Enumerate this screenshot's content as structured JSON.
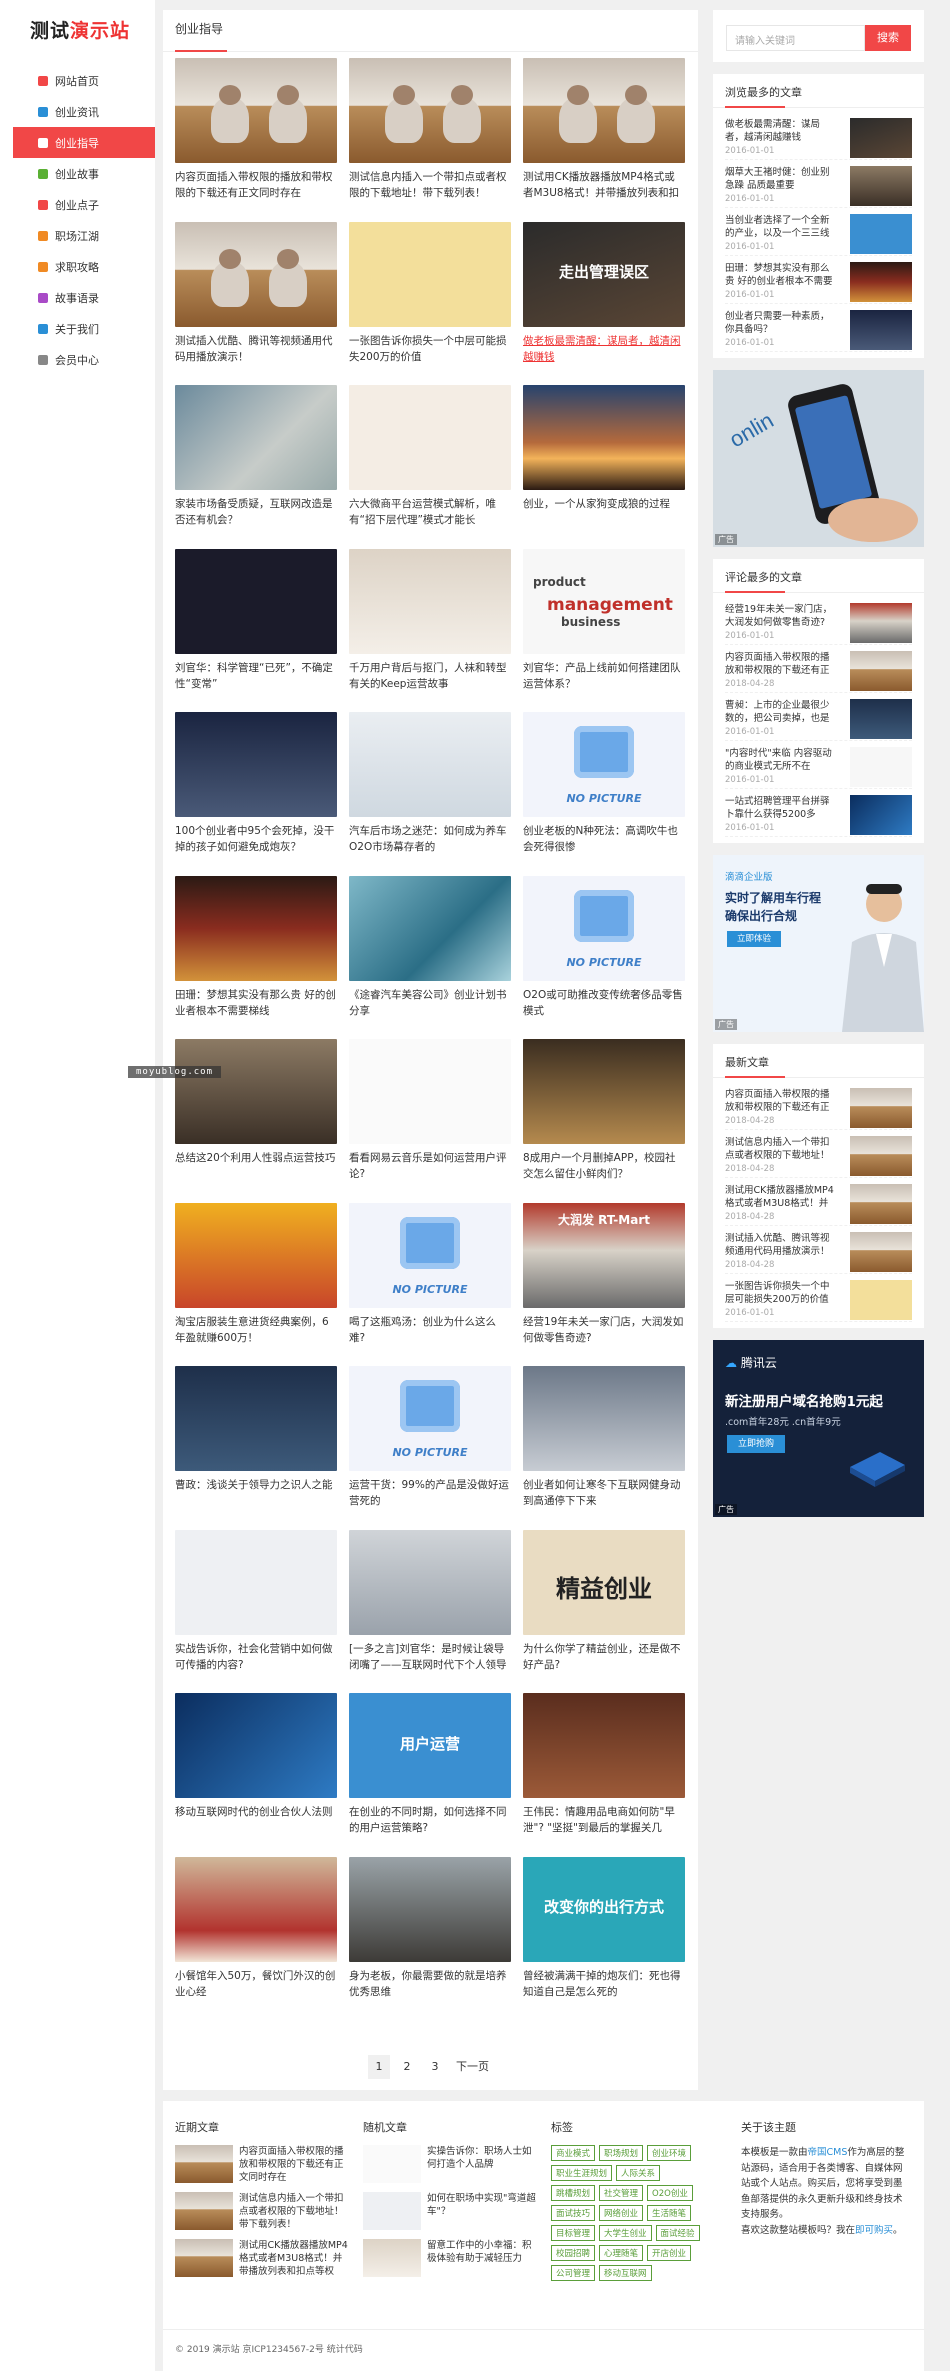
{
  "site": {
    "logo_a": "测试",
    "logo_b": "演示站"
  },
  "nav": [
    {
      "label": "网站首页",
      "icon": "home-icon",
      "color": "#f14747"
    },
    {
      "label": "创业资讯",
      "icon": "question-icon",
      "color": "#2a8fd6"
    },
    {
      "label": "创业指导",
      "icon": "send-icon",
      "color": "#f14747",
      "active": true
    },
    {
      "label": "创业故事",
      "icon": "heart-icon",
      "color": "#5ab034"
    },
    {
      "label": "创业点子",
      "icon": "gift-icon",
      "color": "#f14747"
    },
    {
      "label": "职场江湖",
      "icon": "tag-icon",
      "color": "#f08a24"
    },
    {
      "label": "求职攻略",
      "icon": "page-icon",
      "color": "#f08a24"
    },
    {
      "label": "故事语录",
      "icon": "list-icon",
      "color": "#a94bc7"
    },
    {
      "label": "关于我们",
      "icon": "star-icon",
      "color": "#2a8fd6"
    },
    {
      "label": "会员中心",
      "icon": "user-icon",
      "color": "#888888"
    }
  ],
  "main": {
    "heading": "创业指导",
    "cards": [
      {
        "title": "内容页面插入带权限的播放和带权限的下载还有正文同时存在",
        "thumb": "t-photo1"
      },
      {
        "title": "测试信息内插入一个带扣点或者权限的下载地址！带下载列表！",
        "thumb": "t-photo1"
      },
      {
        "title": "测试用CK播放器播放MP4格式或者M3U8格式！并带播放列表和扣点等权限！",
        "thumb": "t-photo1"
      },
      {
        "title": "测试插入优酷、腾讯等视频通用代码用播放演示！",
        "thumb": "t-photo1"
      },
      {
        "title": "一张图告诉你损失一个中层可能损失200万的价值",
        "thumb": "t-yellow"
      },
      {
        "title": "做老板最需清醒：谋局者，越清闲越赚钱",
        "thumb": "t-dark",
        "red": true,
        "overlay": "走出管理误区"
      },
      {
        "title": "家装市场备受质疑，互联网改造是否还有机会？",
        "thumb": "t-phone"
      },
      {
        "title": "六大微商平台运营模式解析，唯有“招下层代理”模式才能长",
        "thumb": "t-grid6"
      },
      {
        "title": "创业，一个从家狗变成狼的过程",
        "thumb": "t-sunset"
      },
      {
        "title": "刘官华：科学管理“已死”，不确定性“变常”",
        "thumb": "t-slide"
      },
      {
        "title": "千万用户背后与抠门，人袜和转型有关的Keep运营故事",
        "thumb": "t-room"
      },
      {
        "title": "刘官华：产品上线前如何搭建团队运营体系？",
        "thumb": "t-words",
        "overlay_words": [
          "product",
          "management",
          "business"
        ]
      },
      {
        "title": "100个创业者中95个会死掉，没干掉的孩子如何避免成炮灰？",
        "thumb": "t-night"
      },
      {
        "title": "汽车后市场之迷茫：如何成为养车O2O市场幕存者的",
        "thumb": "t-tire"
      },
      {
        "title": "创业老板的N种死法：高调吹牛也会死得很惨",
        "thumb": "t-nopic",
        "nopic": "NO PICTURE"
      },
      {
        "title": "田珊：梦想其实没有那么贵 好的创业者根本不需要梯线",
        "thumb": "t-temple"
      },
      {
        "title": "《途睿汽车美容公司》创业计划书分享",
        "thumb": "t-car"
      },
      {
        "title": "O2O或可助推改变传统奢侈品零售模式",
        "thumb": "t-nopic",
        "nopic": "NO PICTURE"
      },
      {
        "title": "总结这20个利用人性弱点运营技巧",
        "thumb": "t-man"
      },
      {
        "title": "看看网易云音乐是如何运营用户评论?",
        "thumb": "t-chat"
      },
      {
        "title": "8成用户一个月删掉APP，校园社交怎么留住小鲜肉们？",
        "thumb": "t-cafe"
      },
      {
        "title": "淘宝店服装生意进货经典案例，6年盈就赚600万！",
        "thumb": "t-crowd"
      },
      {
        "title": "喝了这瓶鸡汤：创业为什么这么难?",
        "thumb": "t-nopic",
        "nopic": "NO PICTURE"
      },
      {
        "title": "经营19年未关一家门店，大润发如何做零售奇迹?",
        "thumb": "t-store",
        "overlay": "大润发 RT-Mart"
      },
      {
        "title": "曹政：浅谈关于领导力之识人之能",
        "thumb": "t-people"
      },
      {
        "title": "运营干货：99%的产品是没做好运营死的",
        "thumb": "t-nopic",
        "nopic": "NO PICTURE"
      },
      {
        "title": "创业者如何让寒冬下互联网健身动到高通停下下来",
        "thumb": "t-run"
      },
      {
        "title": "实战告诉你，社会化营销中如何做可传播的内容?",
        "thumb": "t-collage"
      },
      {
        "title": "[一多之言]刘官华：是时候让袋导闭嘴了——互联网时代下个人领导力提升",
        "thumb": "t-portrait"
      },
      {
        "title": "为什么你学了精益创业，还是做不好产品?",
        "thumb": "t-calli",
        "overlay": "精益创业"
      },
      {
        "title": "移动互联网时代的创业合伙人法则",
        "thumb": "t-tech"
      },
      {
        "title": "在创业的不同时期，如何选择不同的用户运营策略?",
        "thumb": "t-blue",
        "overlay": "用户运营"
      },
      {
        "title": "王伟民：情趣用品电商如何防\"早泄\"? \"坚挺\"到最后的掌握关几",
        "thumb": "t-brick"
      },
      {
        "title": "小餐馆年入50万，餐饮门外汉的创业心经",
        "thumb": "t-diner"
      },
      {
        "title": "身为老板，你最需要做的就是培养优秀思维",
        "thumb": "t-warriors"
      },
      {
        "title": "曾经被满满干掉的炮灰们：死也得知道自己是怎么死的",
        "thumb": "t-teal",
        "overlay": "改变你的出行方式"
      }
    ]
  },
  "pager": {
    "pages": [
      "1",
      "2",
      "3"
    ],
    "next": "下一页"
  },
  "search": {
    "placeholder": "请输入关键词",
    "button": "搜索"
  },
  "hot": {
    "heading": "浏览最多的文章",
    "items": [
      {
        "title": "做老板最需清醒：谋局者，越清闲越赚钱",
        "date": "2016-01-01",
        "thumb": "t-dark"
      },
      {
        "title": "烟草大王褚时健：创业别急躁 品质最重要",
        "date": "2016-01-01",
        "thumb": "t-man"
      },
      {
        "title": "当创业者选择了一个全新的产业，以及一个三三线城市，该怎么办？",
        "date": "2016-01-01",
        "thumb": "t-blue"
      },
      {
        "title": "田珊：梦想其实没有那么贵 好的创业者根本不需要梯线",
        "date": "2016-01-01",
        "thumb": "t-temple"
      },
      {
        "title": "创业者只需要一种素质，你具备吗？",
        "date": "2016-01-01",
        "thumb": "t-night"
      }
    ]
  },
  "ad1": {
    "tag": "广告"
  },
  "comments": {
    "heading": "评论最多的文章",
    "items": [
      {
        "title": "经营19年未关一家门店，大润发如何做零售奇迹?",
        "date": "2016-01-01",
        "thumb": "t-store"
      },
      {
        "title": "内容页面插入带权限的播放和带权限的下载还有正文同时存在",
        "date": "2018-04-28",
        "thumb": "t-photo1"
      },
      {
        "title": "曹昶：上市的企业最很少数的，把公司卖掉，也是创业者很好的选择",
        "date": "2016-01-01",
        "thumb": "t-people"
      },
      {
        "title": "\"内容时代\"来临 内容驱动的商业模式无所不在",
        "date": "2016-01-01",
        "thumb": "t-words"
      },
      {
        "title": "一站式招聘管理平台拼驿卜靠什么获得5200多",
        "date": "2016-01-01",
        "thumb": "t-tech"
      }
    ]
  },
  "ad2": {
    "brand": "滴滴企业版",
    "headline": "实时了解用车行程",
    "sub": "确保出行合规",
    "cta": "立即体验",
    "tag": "广告"
  },
  "latest": {
    "heading": "最新文章",
    "items": [
      {
        "title": "内容页面插入带权限的播放和带权限的下载还有正文同时存在",
        "date": "2018-04-28",
        "thumb": "t-photo1"
      },
      {
        "title": "测试信息内插入一个带扣点或者权限的下载地址！带下载列表！",
        "date": "2018-04-28",
        "thumb": "t-photo1"
      },
      {
        "title": "测试用CK播放器播放MP4格式或者M3U8格式！并带播放列表和扣点等权限！",
        "date": "2018-04-28",
        "thumb": "t-photo1"
      },
      {
        "title": "测试插入优酷、腾讯等视频通用代码用播放演示！",
        "date": "2018-04-28",
        "thumb": "t-photo1"
      },
      {
        "title": "一张图告诉你损失一个中层可能损失200万的价值",
        "date": "2016-01-01",
        "thumb": "t-yellow"
      }
    ]
  },
  "ad3": {
    "brand": "腾讯云",
    "headline": "新注册用户域名抢购1元起",
    "sub": ".com首年28元 .cn首年9元",
    "cta": "立即抢购",
    "tag": "广告"
  },
  "footer": {
    "recent": {
      "heading": "近期文章",
      "items": [
        {
          "title": "内容页面插入带权限的播放和带权限的下载还有正文同时存在",
          "thumb": "t-photo1"
        },
        {
          "title": "测试信息内插入一个带扣点或者权限的下载地址！带下载列表！",
          "thumb": "t-photo1"
        },
        {
          "title": "测试用CK播放器播放MP4格式或者M3U8格式！并带播放列表和扣点等权限！",
          "thumb": "t-photo1"
        }
      ]
    },
    "random": {
      "heading": "随机文章",
      "items": [
        {
          "title": "实操告诉你：职场人士如何打造个人品牌",
          "thumb": "t-chat"
        },
        {
          "title": "如何在职场中实现\"弯道超车\"？",
          "thumb": "t-collage"
        },
        {
          "title": "留意工作中的小幸福：积极体验有助于减轻压力",
          "thumb": "t-room"
        }
      ]
    },
    "tags": {
      "heading": "标签",
      "items": [
        "商业模式",
        "职场规划",
        "创业环境",
        "职业生涯规划",
        "人际关系",
        "跳槽规划",
        "社交管理",
        "O2O创业",
        "面试技巧",
        "网络创业",
        "生活随笔",
        "目标管理",
        "大学生创业",
        "面试经验",
        "校园招聘",
        "心理随笔",
        "开店创业",
        "公司管理",
        "移动互联网"
      ]
    },
    "about": {
      "heading": "关于该主题",
      "text_a": "本模板是一款由",
      "link_a": "帝国CMS",
      "text_b": "作为高层的整站源码，适合用于各类博客、自媒体网站或个人站点。购买后，您将享受到墨鱼部落提供的永久更新升级和终身技术支持服务。",
      "text_c": "喜欢这款整站模板吗？我在",
      "link_b": "即可购买",
      "text_d": "。"
    },
    "copyright": "© 2019 演示站 京ICP1234567-2号 统计代码"
  },
  "watermark": "moyublog.com"
}
